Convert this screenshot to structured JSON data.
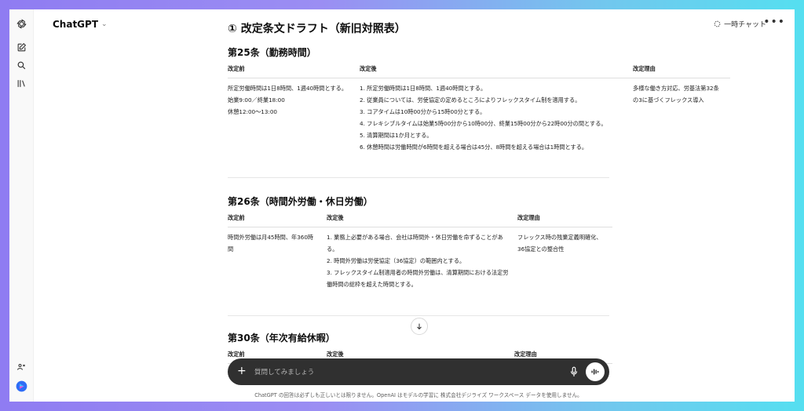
{
  "app": {
    "model_label": "ChatGPT",
    "temp_chat_label": "一時チャット",
    "more_label": "•••"
  },
  "rail": {
    "icons": [
      "openai-logo-icon",
      "new-chat-icon",
      "search-icon",
      "library-icon",
      "apps-icon",
      "profile-icon"
    ]
  },
  "doc": {
    "title": "① 改定条文ドラフト（新旧対照表）",
    "headers": {
      "before": "改定前",
      "after": "改定後",
      "reason": "改定理由"
    },
    "articles": [
      {
        "heading": "第25条（勤務時間）",
        "before": [
          "所定労働時間は1日8時間、1週40時間とする。",
          "始業9:00／終業18:00",
          "休憩12:00～13:00"
        ],
        "after": [
          "1. 所定労働時間は1日8時間、1週40時間とする。",
          "2. 従業員については、労使協定の定めるところによりフレックスタイム制を適用する。",
          "3. コアタイムは10時00分から15時00分とする。",
          "4. フレキシブルタイムは始業5時00分から10時00分、終業15時00分から22時00分の間とする。",
          "5. 清算期間は1か月とする。",
          "6. 休憩時間は労働時間が6時間を超える場合は45分、8時間を超える場合は1時間とする。"
        ],
        "reason": "多様な働き方対応、労基法第32条の3に基づくフレックス導入"
      },
      {
        "heading": "第26条（時間外労働・休日労働）",
        "before": [
          "時間外労働は月45時間、年360時間"
        ],
        "after": [
          "1. 業務上必要がある場合、会社は時間外・休日労働を命ずることがある。",
          "2. 時間外労働は労使協定（36協定）の範囲内とする。",
          "3. フレックスタイム制適用者の時間外労働は、清算期間における法定労働時間の総枠を超えた時間とする。"
        ],
        "reason": "フレックス時の残業定義明確化、36協定との整合性"
      },
      {
        "heading": "第30条（年次有給休暇）"
      }
    ]
  },
  "composer": {
    "placeholder": "質問してみましょう"
  },
  "footer": {
    "disclaimer": "ChatGPT の回答は必ずしも正しいとは限りません。OpenAI はモデルの学習に 株式会社デジライズ ワークスペース データを使用しません。"
  }
}
